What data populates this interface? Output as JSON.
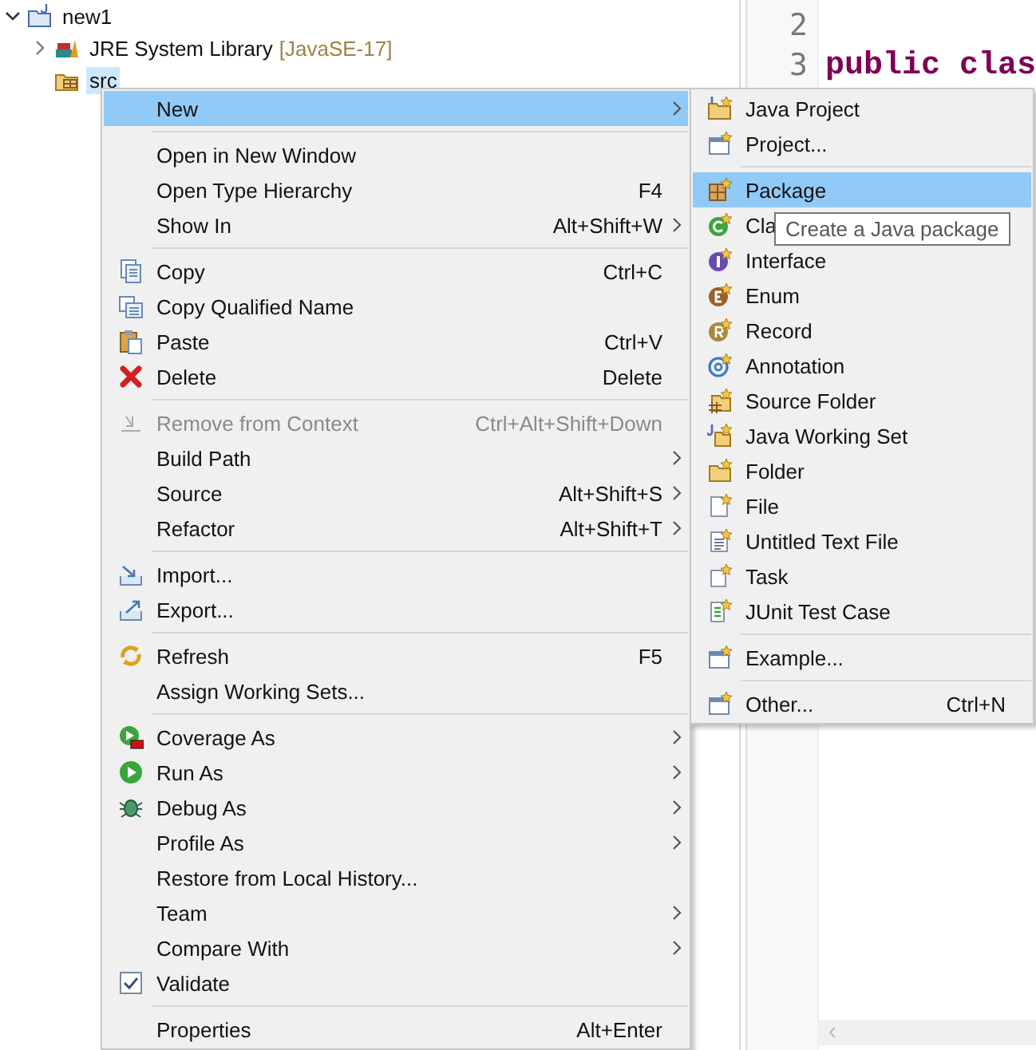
{
  "tree": [
    {
      "label": "new1",
      "expanded": true,
      "children": [
        {
          "label": "JRE System Library",
          "decoration": "[JavaSE-17]",
          "expanded": false,
          "selected": false
        },
        {
          "label": "src",
          "selected": true
        }
      ]
    }
  ],
  "editor": {
    "lines": [
      {
        "number": "2"
      },
      {
        "number": "3",
        "code": "public clas"
      }
    ]
  },
  "context_menu": {
    "items": [
      {
        "kind": "item",
        "label": "New",
        "submenu": true,
        "selected": true,
        "disabled": false
      },
      {
        "kind": "separator"
      },
      {
        "kind": "item",
        "label": "Open in New Window",
        "submenu": false,
        "selected": false,
        "disabled": false
      },
      {
        "kind": "item",
        "label": "Open Type Hierarchy",
        "shortcut": "F4",
        "submenu": false,
        "selected": false,
        "disabled": false
      },
      {
        "kind": "item",
        "label": "Show In",
        "shortcut": "Alt+Shift+W",
        "submenu": true,
        "selected": false,
        "disabled": false
      },
      {
        "kind": "separator"
      },
      {
        "kind": "item",
        "label": "Copy",
        "shortcut": "Ctrl+C",
        "submenu": false,
        "selected": false,
        "disabled": false
      },
      {
        "kind": "item",
        "label": "Copy Qualified Name",
        "submenu": false,
        "selected": false,
        "disabled": false
      },
      {
        "kind": "item",
        "label": "Paste",
        "shortcut": "Ctrl+V",
        "submenu": false,
        "selected": false,
        "disabled": false
      },
      {
        "kind": "item",
        "label": "Delete",
        "shortcut": "Delete",
        "submenu": false,
        "selected": false,
        "disabled": false
      },
      {
        "kind": "separator"
      },
      {
        "kind": "item",
        "label": "Remove from Context",
        "shortcut": "Ctrl+Alt+Shift+Down",
        "submenu": false,
        "selected": false,
        "disabled": true
      },
      {
        "kind": "item",
        "label": "Build Path",
        "submenu": true,
        "selected": false,
        "disabled": false
      },
      {
        "kind": "item",
        "label": "Source",
        "shortcut": "Alt+Shift+S",
        "submenu": true,
        "selected": false,
        "disabled": false
      },
      {
        "kind": "item",
        "label": "Refactor",
        "shortcut": "Alt+Shift+T",
        "submenu": true,
        "selected": false,
        "disabled": false
      },
      {
        "kind": "separator"
      },
      {
        "kind": "item",
        "label": "Import...",
        "submenu": false,
        "selected": false,
        "disabled": false
      },
      {
        "kind": "item",
        "label": "Export...",
        "submenu": false,
        "selected": false,
        "disabled": false
      },
      {
        "kind": "separator"
      },
      {
        "kind": "item",
        "label": "Refresh",
        "shortcut": "F5",
        "submenu": false,
        "selected": false,
        "disabled": false
      },
      {
        "kind": "item",
        "label": "Assign Working Sets...",
        "submenu": false,
        "selected": false,
        "disabled": false
      },
      {
        "kind": "separator"
      },
      {
        "kind": "item",
        "label": "Coverage As",
        "submenu": true,
        "selected": false,
        "disabled": false
      },
      {
        "kind": "item",
        "label": "Run As",
        "submenu": true,
        "selected": false,
        "disabled": false
      },
      {
        "kind": "item",
        "label": "Debug As",
        "submenu": true,
        "selected": false,
        "disabled": false
      },
      {
        "kind": "item",
        "label": "Profile As",
        "submenu": true,
        "selected": false,
        "disabled": false
      },
      {
        "kind": "item",
        "label": "Restore from Local History...",
        "submenu": false,
        "selected": false,
        "disabled": false
      },
      {
        "kind": "item",
        "label": "Team",
        "submenu": true,
        "selected": false,
        "disabled": false
      },
      {
        "kind": "item",
        "label": "Compare With",
        "submenu": true,
        "selected": false,
        "disabled": false
      },
      {
        "kind": "item",
        "label": "Validate",
        "submenu": false,
        "selected": false,
        "disabled": false
      },
      {
        "kind": "separator"
      },
      {
        "kind": "item",
        "label": "Properties",
        "shortcut": "Alt+Enter",
        "submenu": false,
        "selected": false,
        "disabled": false
      }
    ]
  },
  "new_submenu": {
    "items": [
      {
        "kind": "item",
        "label": "Java Project",
        "selected": false
      },
      {
        "kind": "item",
        "label": "Project...",
        "selected": false
      },
      {
        "kind": "separator"
      },
      {
        "kind": "item",
        "label": "Package",
        "selected": true
      },
      {
        "kind": "item",
        "label": "Cla",
        "selected": false
      },
      {
        "kind": "item",
        "label": "Interface",
        "selected": false
      },
      {
        "kind": "item",
        "label": "Enum",
        "selected": false
      },
      {
        "kind": "item",
        "label": "Record",
        "selected": false
      },
      {
        "kind": "item",
        "label": "Annotation",
        "selected": false
      },
      {
        "kind": "item",
        "label": "Source Folder",
        "selected": false
      },
      {
        "kind": "item",
        "label": "Java Working Set",
        "selected": false
      },
      {
        "kind": "item",
        "label": "Folder",
        "selected": false
      },
      {
        "kind": "item",
        "label": "File",
        "selected": false
      },
      {
        "kind": "item",
        "label": "Untitled Text File",
        "selected": false
      },
      {
        "kind": "item",
        "label": "Task",
        "selected": false
      },
      {
        "kind": "item",
        "label": "JUnit Test Case",
        "selected": false
      },
      {
        "kind": "separator"
      },
      {
        "kind": "item",
        "label": "Example...",
        "selected": false
      },
      {
        "kind": "separator"
      },
      {
        "kind": "item",
        "label": "Other...",
        "shortcut": "Ctrl+N",
        "selected": false
      }
    ]
  },
  "tooltip": {
    "text": "Create a Java package"
  }
}
